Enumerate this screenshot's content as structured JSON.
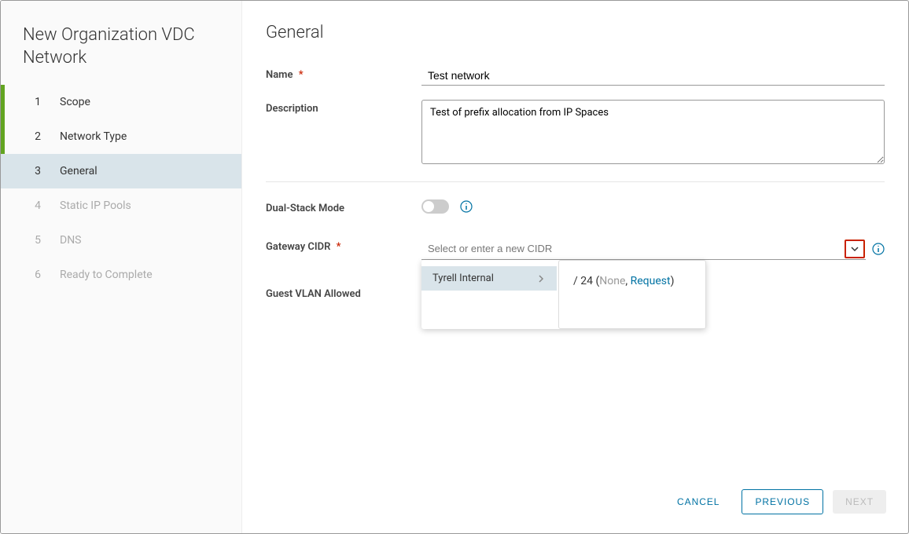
{
  "wizard": {
    "title": "New Organization VDC Network",
    "steps": [
      {
        "num": "1",
        "label": "Scope",
        "state": "completed"
      },
      {
        "num": "2",
        "label": "Network Type",
        "state": "completed"
      },
      {
        "num": "3",
        "label": "General",
        "state": "active"
      },
      {
        "num": "4",
        "label": "Static IP Pools",
        "state": "disabled"
      },
      {
        "num": "5",
        "label": "DNS",
        "state": "disabled"
      },
      {
        "num": "6",
        "label": "Ready to Complete",
        "state": "disabled"
      }
    ]
  },
  "page": {
    "title": "General"
  },
  "form": {
    "name": {
      "label": "Name",
      "required": "*",
      "value": "Test network"
    },
    "description": {
      "label": "Description",
      "value": "Test of prefix allocation from IP Spaces"
    },
    "dual_stack": {
      "label": "Dual-Stack Mode"
    },
    "gateway_cidr": {
      "label": "Gateway CIDR",
      "required": "*",
      "placeholder": "Select or enter a new CIDR",
      "dropdown": {
        "option1": "Tyrell Internal",
        "panel2_prefix": "/ 24 (",
        "panel2_none": "None",
        "panel2_sep": ", ",
        "panel2_request": "Request",
        "panel2_close": ")"
      }
    },
    "guest_vlan": {
      "label": "Guest VLAN Allowed"
    }
  },
  "footer": {
    "cancel": "CANCEL",
    "previous": "PREVIOUS",
    "next": "NEXT"
  }
}
